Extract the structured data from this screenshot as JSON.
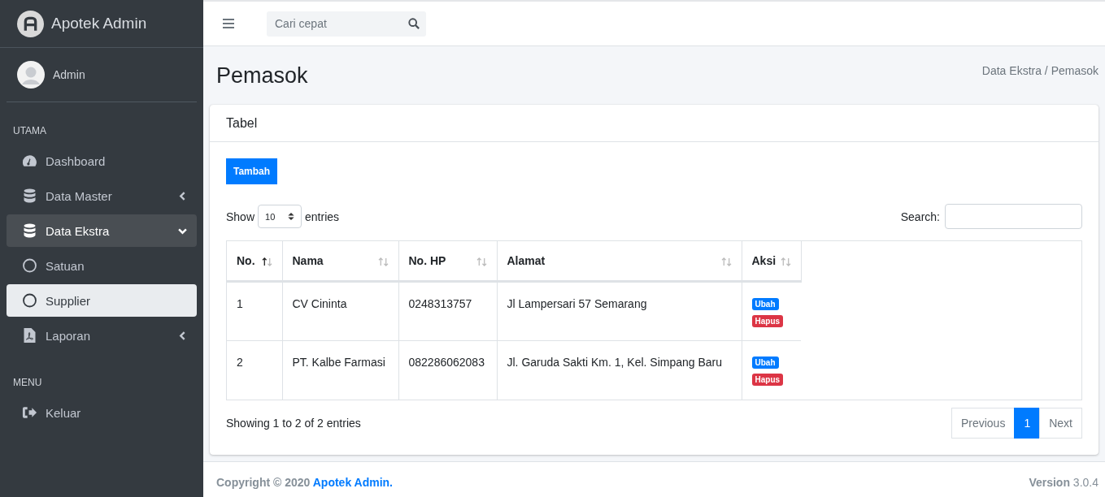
{
  "brand": {
    "name": "Apotek Admin"
  },
  "user": {
    "name": "Admin"
  },
  "sidebar": {
    "sections": [
      {
        "header": "UTAMA",
        "items": [
          {
            "label": "Dashboard",
            "expandable": false,
            "expanded": false
          },
          {
            "label": "Data Master",
            "expandable": true,
            "expanded": false
          },
          {
            "label": "Data Ekstra",
            "expandable": true,
            "expanded": true,
            "children": [
              {
                "label": "Satuan",
                "selected": false
              },
              {
                "label": "Supplier",
                "selected": true
              }
            ]
          },
          {
            "label": "Laporan",
            "expandable": true,
            "expanded": false
          }
        ]
      },
      {
        "header": "MENU",
        "items": [
          {
            "label": "Keluar",
            "expandable": false,
            "expanded": false
          }
        ]
      }
    ]
  },
  "topbar": {
    "search": {
      "placeholder": "Cari cepat"
    }
  },
  "page": {
    "title": "Pemasok",
    "breadcrumb": "Data Ekstra / Pemasok"
  },
  "card": {
    "title": "Tabel",
    "add_button": "Tambah",
    "length": {
      "before": "Show",
      "value": "10",
      "after": "entries"
    },
    "search_label": "Search:",
    "table": {
      "columns": [
        {
          "label": "No.",
          "sorted": true
        },
        {
          "label": "Nama",
          "sorted": false
        },
        {
          "label": "No. HP",
          "sorted": false
        },
        {
          "label": "Alamat",
          "sorted": false
        },
        {
          "label": "Aksi",
          "sorted": false
        }
      ],
      "rows": [
        {
          "no": "1",
          "nama": "CV Cininta",
          "hp": "0248313757",
          "alamat": "Jl Lampersari 57 Semarang",
          "actions": [
            {
              "label": "Ubah",
              "kind": "edit"
            },
            {
              "label": "Hapus",
              "kind": "delete"
            }
          ]
        },
        {
          "no": "2",
          "nama": "PT. Kalbe Farmasi",
          "hp": "082286062083",
          "alamat": "Jl. Garuda Sakti Km. 1, Kel. Simpang Baru",
          "actions": [
            {
              "label": "Ubah",
              "kind": "edit"
            },
            {
              "label": "Hapus",
              "kind": "delete"
            }
          ]
        }
      ]
    },
    "info": "Showing 1 to 2 of 2 entries",
    "pagination": {
      "previous": {
        "label": "Previous",
        "disabled": true
      },
      "pages": [
        {
          "label": "1",
          "selected": true
        }
      ],
      "next": {
        "label": "Next",
        "disabled": true
      }
    }
  },
  "footer": {
    "copyright": "Copyright © 2020 ",
    "link": "Apotek Admin.",
    "version_label": "Version",
    "version": " 3.0.4"
  }
}
